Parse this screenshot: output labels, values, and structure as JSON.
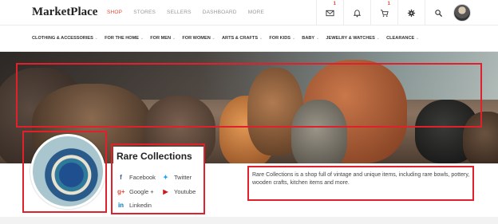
{
  "header": {
    "logo": "MarketPlace",
    "nav": [
      {
        "label": "SHOP",
        "active": true
      },
      {
        "label": "STORES",
        "active": false
      },
      {
        "label": "SELLERS",
        "active": false
      },
      {
        "label": "DASHBOARD",
        "active": false
      },
      {
        "label": "MORE",
        "active": false
      }
    ],
    "icons": [
      {
        "name": "mail-icon",
        "badge": "1"
      },
      {
        "name": "bell-icon",
        "badge": ""
      },
      {
        "name": "cart-icon",
        "badge": "1"
      },
      {
        "name": "gear-icon",
        "badge": ""
      },
      {
        "name": "search-icon",
        "badge": ""
      }
    ]
  },
  "categories": [
    "CLOTHING & ACCESSORIES",
    "FOR THE HOME",
    "FOR MEN",
    "FOR WOMEN",
    "ARTS & CRAFTS",
    "FOR KIDS",
    "BABY",
    "JEWELRY & WATCHES",
    "CLEARANCE"
  ],
  "shop": {
    "name": "Rare Collections",
    "description": "Rare Collections is a shop full of vintage and unique items, including rare bowls, pottery, wooden crafts, kitchen items and more.",
    "social": [
      {
        "icon": "facebook-icon",
        "glyph": "f",
        "color": "#3b5998",
        "label": "Facebook"
      },
      {
        "icon": "twitter-icon",
        "glyph": "✦",
        "color": "#1da1f2",
        "label": "Twitter"
      },
      {
        "icon": "google-plus-icon",
        "glyph": "g+",
        "color": "#dd4b39",
        "label": "Google +"
      },
      {
        "icon": "youtube-icon",
        "glyph": "▶",
        "color": "#cc181e",
        "label": "Youtube"
      },
      {
        "icon": "linkedin-icon",
        "glyph": "in",
        "color": "#0077b5",
        "label": "Linkedin"
      }
    ]
  },
  "colors": {
    "accent": "#e8492e",
    "highlight_box": "#e0202a"
  }
}
